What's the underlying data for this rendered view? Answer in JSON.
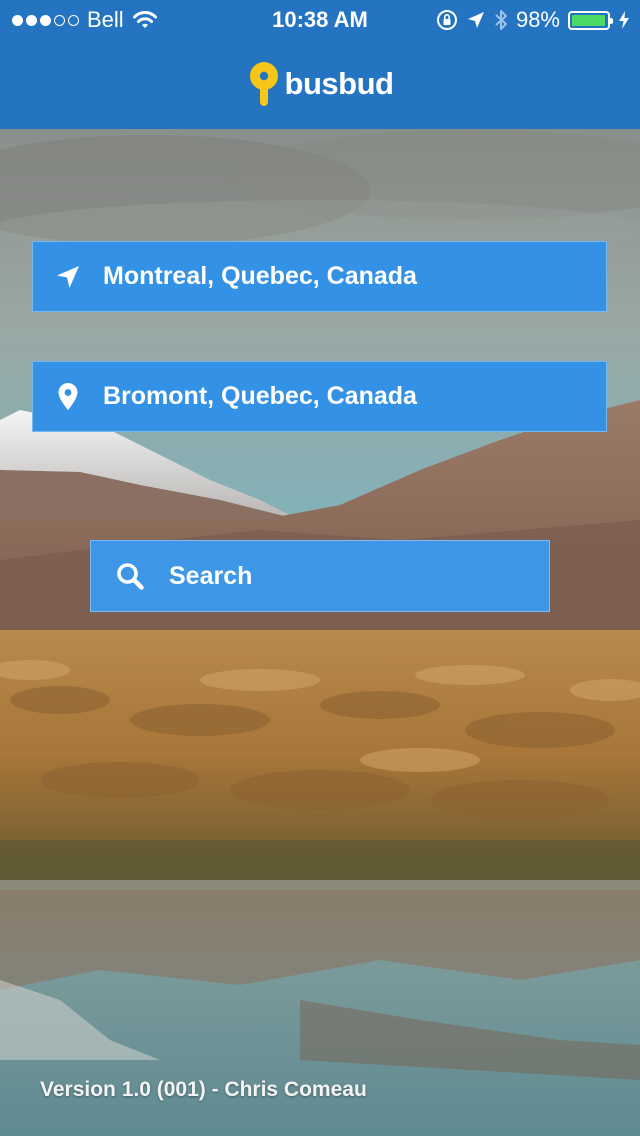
{
  "status_bar": {
    "carrier": "Bell",
    "time": "10:38 AM",
    "battery_percent_label": "98%",
    "battery_level": 0.98,
    "signal_bars_filled": 3,
    "signal_bars_total": 5
  },
  "header": {
    "brand": "busbud",
    "brand_color": "#f5c518",
    "background": "#2474c2"
  },
  "search_form": {
    "origin": "Montreal, Quebec, Canada",
    "destination": "Bromont, Quebec, Canada",
    "search_label": "Search"
  },
  "footer": {
    "version_text": "Version 1.0 (001) - Chris Comeau"
  },
  "icons": {
    "origin": "location-arrow-icon",
    "destination": "map-pin-icon",
    "search": "search-icon"
  }
}
